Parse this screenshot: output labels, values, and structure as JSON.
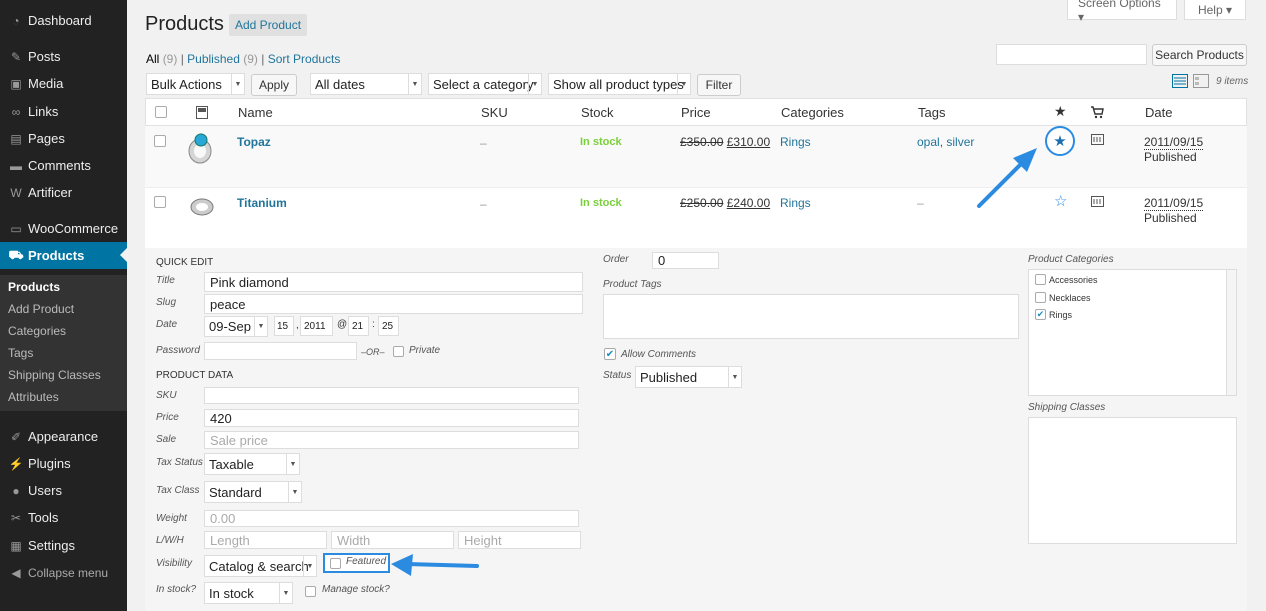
{
  "sidebar": {
    "items": [
      {
        "label": "Dashboard",
        "icon": "dashboard-icon",
        "glyph": "◔"
      },
      {
        "label": "Posts",
        "icon": "pin-icon",
        "glyph": "✎"
      },
      {
        "label": "Media",
        "icon": "media-icon",
        "glyph": "▣"
      },
      {
        "label": "Links",
        "icon": "links-icon",
        "glyph": "∞"
      },
      {
        "label": "Pages",
        "icon": "pages-icon",
        "glyph": "▤"
      },
      {
        "label": "Comments",
        "icon": "comments-icon",
        "glyph": "▬"
      },
      {
        "label": "Artificer",
        "icon": "artificer-icon",
        "glyph": "W"
      },
      {
        "label": "WooCommerce",
        "icon": "woocommerce-icon",
        "glyph": "▭"
      },
      {
        "label": "Products",
        "icon": "cart-icon",
        "glyph": "⛟"
      },
      {
        "label": "Appearance",
        "icon": "brush-icon",
        "glyph": "✐"
      },
      {
        "label": "Plugins",
        "icon": "plugin-icon",
        "glyph": "⚡"
      },
      {
        "label": "Users",
        "icon": "users-icon",
        "glyph": "●"
      },
      {
        "label": "Tools",
        "icon": "wrench-icon",
        "glyph": "✂"
      },
      {
        "label": "Settings",
        "icon": "settings-icon",
        "glyph": "▦"
      },
      {
        "label": "Collapse menu",
        "icon": "collapse-icon",
        "glyph": "◀"
      }
    ],
    "submenu": [
      "Products",
      "Add Product",
      "Categories",
      "Tags",
      "Shipping Classes",
      "Attributes"
    ]
  },
  "header": {
    "title": "Products",
    "add_button": "Add Product",
    "screen_options": "Screen Options ▾",
    "help": "Help ▾"
  },
  "views": {
    "all": "All",
    "all_count": "(9)",
    "published": "Published",
    "published_count": "(9)",
    "sort": "Sort Products"
  },
  "filters": {
    "bulk": "Bulk Actions",
    "apply": "Apply",
    "dates": "All dates",
    "category": "Select a category",
    "types": "Show all product types",
    "filter": "Filter",
    "search_button": "Search Products",
    "items": "9 items"
  },
  "table": {
    "columns": {
      "name": "Name",
      "sku": "SKU",
      "stock": "Stock",
      "price": "Price",
      "categories": "Categories",
      "tags": "Tags",
      "date": "Date"
    },
    "rows": [
      {
        "name": "Topaz",
        "sku": "–",
        "stock": "In stock",
        "old_price": "£350.00",
        "price": "£310.00",
        "category": "Rings",
        "tags": [
          "opal",
          "silver"
        ],
        "date": "2011/09/15",
        "status": "Published",
        "featured": true
      },
      {
        "name": "Titanium",
        "sku": "–",
        "stock": "In stock",
        "old_price": "£250.00",
        "price": "£240.00",
        "category": "Rings",
        "tags_empty": "–",
        "date": "2011/09/15",
        "status": "Published",
        "featured": false
      }
    ]
  },
  "quick_edit": {
    "heading": "Quick Edit",
    "title_label": "Title",
    "title_value": "Pink diamond",
    "slug_label": "Slug",
    "slug_value": "peace",
    "date_label": "Date",
    "month": "09-Sep",
    "day": "15",
    "year": "2011",
    "at": "@",
    "hour": "21",
    "colon": ":",
    "minute": "25",
    "comma": ",",
    "password_label": "Password",
    "or": "–OR–",
    "private": "Private",
    "product_data": "Product Data",
    "sku_label": "SKU",
    "price_label": "Price",
    "price_value": "420",
    "sale_label": "Sale",
    "sale_placeholder": "Sale price",
    "tax_status_label": "Tax Status",
    "tax_status": "Taxable",
    "tax_class_label": "Tax Class",
    "tax_class": "Standard",
    "weight_label": "Weight",
    "weight_placeholder": "0.00",
    "lwh_label": "L/W/H",
    "length": "Length",
    "width": "Width",
    "height": "Height",
    "visibility_label": "Visibility",
    "visibility": "Catalog & search",
    "featured": "Featured",
    "instock_label": "In stock?",
    "instock": "In stock",
    "manage_stock": "Manage stock?",
    "order_label": "Order",
    "order_value": "0",
    "tags_label": "Product Tags",
    "allow_comments": "Allow Comments",
    "status_label": "Status",
    "status": "Published",
    "categories_label": "Product Categories",
    "categories": [
      {
        "label": "Accessories",
        "checked": false
      },
      {
        "label": "Necklaces",
        "checked": false
      },
      {
        "label": "Rings",
        "checked": true
      }
    ],
    "shipping_label": "Shipping Classes"
  },
  "colors": {
    "accent": "#0074a2",
    "link": "#21759b",
    "instock": "#7ad03a",
    "annotation": "#2b8be0"
  }
}
